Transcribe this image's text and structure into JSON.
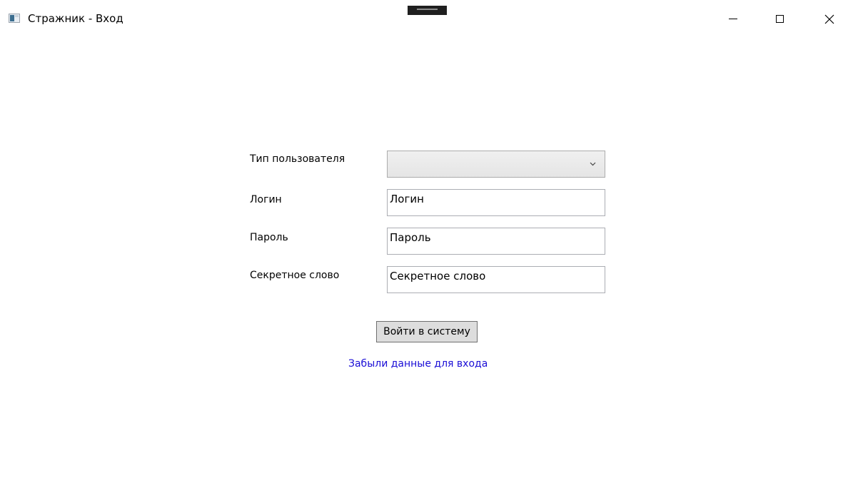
{
  "window": {
    "title": "Стражник - Вход",
    "icons": {
      "app": "app-window-icon",
      "minimize": "minimize-icon",
      "maximize": "maximize-icon",
      "close": "close-icon"
    }
  },
  "form": {
    "user_type_label": "Тип пользователя",
    "user_type_value": "",
    "login_label": "Логин",
    "login_value": "Логин",
    "password_label": "Пароль",
    "password_value": "Пароль",
    "secret_label": "Секретное слово",
    "secret_value": "Секретное слово",
    "submit_label": "Войти в систему",
    "forgot_link": "Забыли данные для входа"
  },
  "colors": {
    "link": "#1a0dd6",
    "button_bg": "#dddddd",
    "combo_bg": "#e9e9e9",
    "border": "#abadb3"
  }
}
